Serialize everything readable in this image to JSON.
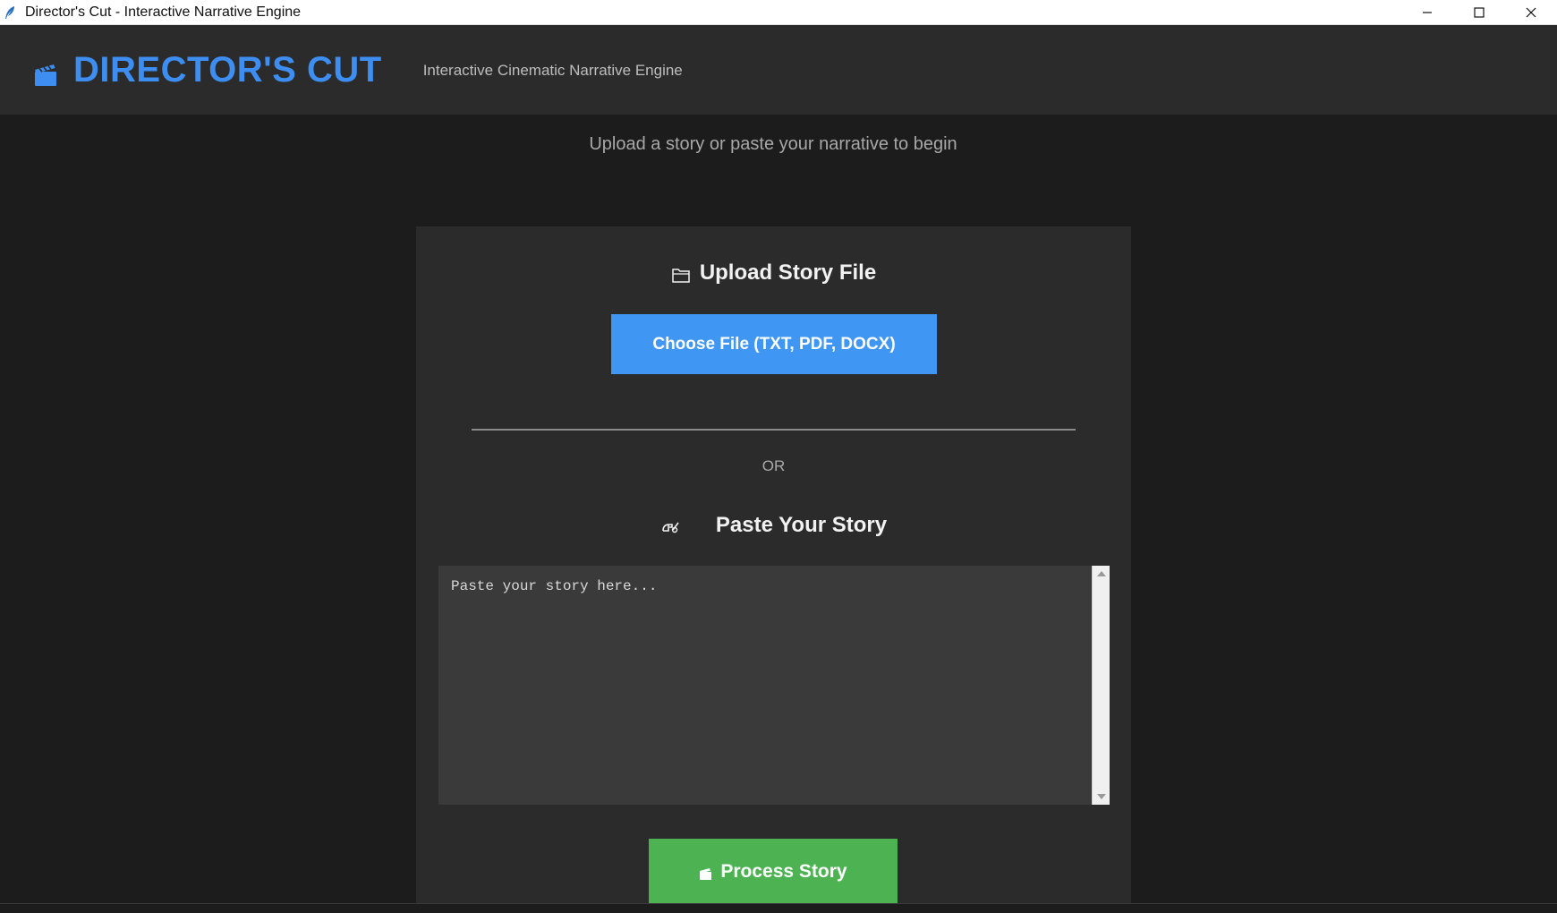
{
  "window": {
    "title": "Director's Cut - Interactive Narrative Engine",
    "icon": "feather-icon",
    "controls": [
      "minimize-icon",
      "maximize-icon",
      "close-icon"
    ]
  },
  "header": {
    "icon": "clapperboard-icon",
    "brand": "DIRECTOR'S CUT",
    "tagline": "Interactive Cinematic Narrative Engine",
    "brand_color": "#3d8ef0"
  },
  "main": {
    "intro": "Upload a story or paste your narrative to begin"
  },
  "upload": {
    "icon": "folder-icon",
    "title": "Upload Story File",
    "choose_button": "Choose File (TXT, PDF, DOCX)",
    "button_color": "#3f96f3"
  },
  "separator": {
    "or_text": "OR"
  },
  "paste": {
    "icon": "writing-hand-icon",
    "title": "Paste Your Story",
    "placeholder": "Paste your story here...",
    "value": ""
  },
  "process": {
    "icon": "clapperboard-icon",
    "label": "Process Story",
    "button_color": "#4db352"
  }
}
